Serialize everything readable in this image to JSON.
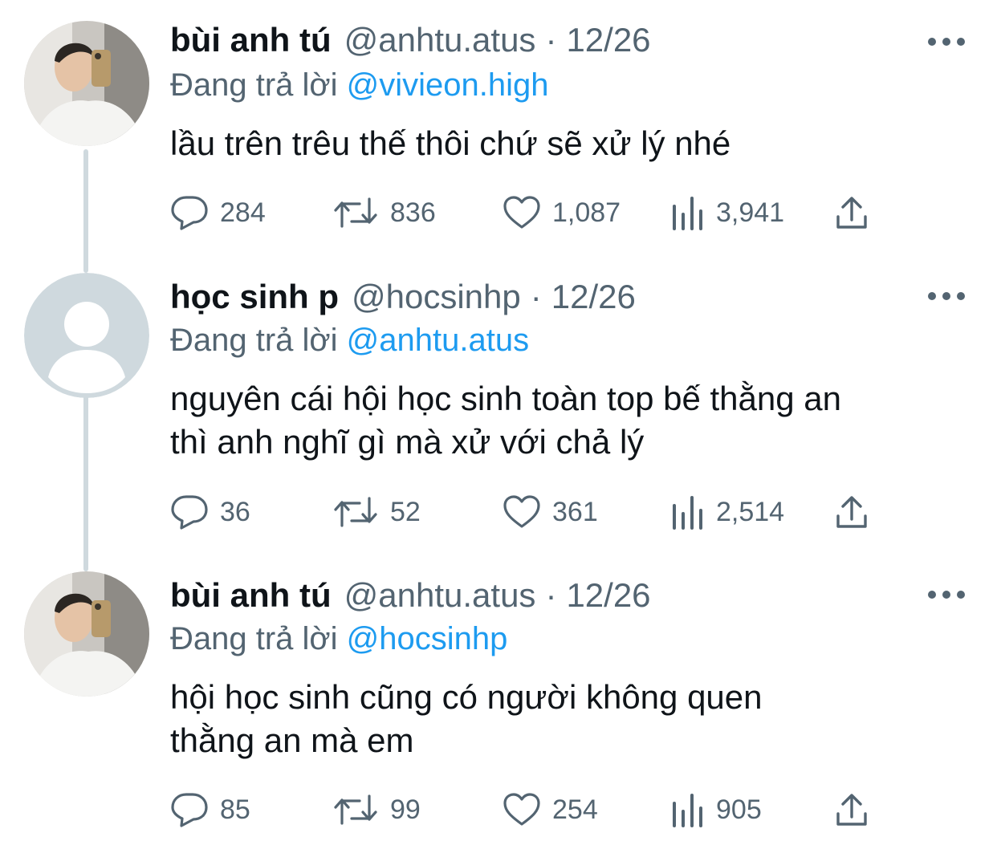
{
  "tweets": [
    {
      "display_name": "bùi anh tú",
      "handle": "@anhtu.atus",
      "separator": "·",
      "date": "12/26",
      "replying_prefix": "Đang trả lời",
      "replying_to": "@vivieon.high",
      "text_lines": [
        "lầu trên trêu thế thôi chứ sẽ xử lý nhé"
      ],
      "replies": "284",
      "retweets": "836",
      "likes": "1,087",
      "views": "3,941"
    },
    {
      "display_name": "học sinh p",
      "handle": "@hocsinhp",
      "separator": "·",
      "date": "12/26",
      "replying_prefix": "Đang trả lời",
      "replying_to": "@anhtu.atus",
      "text_lines": [
        "nguyên cái hội học sinh toàn top bế thằng an",
        "thì anh nghĩ gì mà xử với chả lý"
      ],
      "replies": "36",
      "retweets": "52",
      "likes": "361",
      "views": "2,514"
    },
    {
      "display_name": "bùi anh tú",
      "handle": "@anhtu.atus",
      "separator": "·",
      "date": "12/26",
      "replying_prefix": "Đang trả lời",
      "replying_to": "@hocsinhp",
      "text_lines": [
        "hội học sinh cũng có người không quen",
        "thằng an mà em"
      ],
      "replies": "85",
      "retweets": "99",
      "likes": "254",
      "views": "905"
    }
  ],
  "icons": {
    "reply": "reply-icon",
    "retweet": "retweet-icon",
    "like": "heart-icon",
    "views": "views-icon",
    "share": "share-icon",
    "more": "more-icon"
  },
  "colors": {
    "text": "#0f1419",
    "muted": "#536471",
    "mention": "#1d9bf0",
    "thread_line": "#cfd9de",
    "default_avatar": "#cfd9de"
  }
}
